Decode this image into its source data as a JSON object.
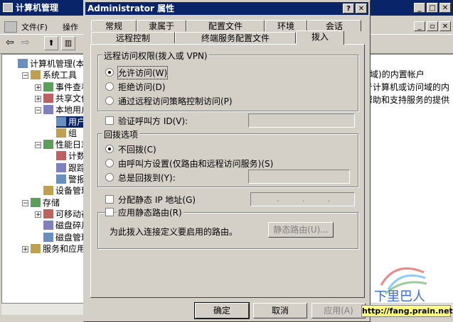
{
  "mmc": {
    "title": "计算机管理",
    "menu": [
      "文件(F)",
      "操作"
    ],
    "tree": [
      {
        "label": "计算机管理(本地",
        "level": 0,
        "expander": ""
      },
      {
        "label": "系统工具",
        "level": 1,
        "expander": "-"
      },
      {
        "label": "事件查看器",
        "level": 2,
        "expander": "+"
      },
      {
        "label": "共享文件夹",
        "level": 2,
        "expander": "+"
      },
      {
        "label": "本地用户和组",
        "level": 2,
        "expander": "-"
      },
      {
        "label": "用户",
        "level": 3,
        "expander": ""
      },
      {
        "label": "组",
        "level": 3,
        "expander": ""
      },
      {
        "label": "性能日志和警报",
        "level": 2,
        "expander": "-"
      },
      {
        "label": "计数器日志",
        "level": 3,
        "expander": ""
      },
      {
        "label": "跟踪日志",
        "level": 3,
        "expander": ""
      },
      {
        "label": "警报",
        "level": 3,
        "expander": ""
      },
      {
        "label": "设备管理器",
        "level": 2,
        "expander": ""
      },
      {
        "label": "存储",
        "level": 1,
        "expander": "-"
      },
      {
        "label": "可移动存储",
        "level": 2,
        "expander": "+"
      },
      {
        "label": "磁盘碎片整理",
        "level": 2,
        "expander": ""
      },
      {
        "label": "磁盘管理",
        "level": 2,
        "expander": ""
      },
      {
        "label": "服务和应用程序",
        "level": 1,
        "expander": "+"
      }
    ],
    "right_lines": [
      "l(域)的内置帐户",
      "亓计算机或访问域的内",
      "帮助和支持服务的提供"
    ]
  },
  "dialog": {
    "title": "Administrator 属性",
    "help_btn": "?",
    "close_btn": "✕",
    "tabs_row1": [
      "常规",
      "隶属于",
      "配置文件",
      "环境",
      "会话"
    ],
    "tabs_row2": [
      "远程控制",
      "终端服务配置文件",
      "拨入"
    ],
    "remote_access": {
      "legend": "远程访问权限(拨入或 VPN)",
      "options": [
        "允许访问(W)",
        "拒绝访问(D)",
        "通过远程访问策略控制访问(P)"
      ],
      "selected": 0
    },
    "verify_caller_id": "验证呼叫方 ID(V):",
    "callback": {
      "legend": "回拨选项",
      "options": [
        "不回拨(C)",
        "由呼叫方设置(仅路由和远程访问服务)(S)",
        "总是回拨到(Y):"
      ],
      "selected": 0
    },
    "static_ip": {
      "label": "分配静态 IP 地址(G)",
      "ip_dots": [
        ".",
        ".",
        "."
      ]
    },
    "static_routes": {
      "label": "应用静态路由(R)",
      "desc": "为此拨入连接定义要启用的路由。",
      "button": "静态路由(U)..."
    },
    "buttons": {
      "ok": "确定",
      "cancel": "取消",
      "apply": "应用(A)"
    }
  },
  "watermark": {
    "text": "下里巴人",
    "url": "http://fang.prain.net"
  },
  "colors": {
    "titlebar": "#0a246a",
    "face": "#d4d0c8",
    "badge": "#ffff80"
  }
}
